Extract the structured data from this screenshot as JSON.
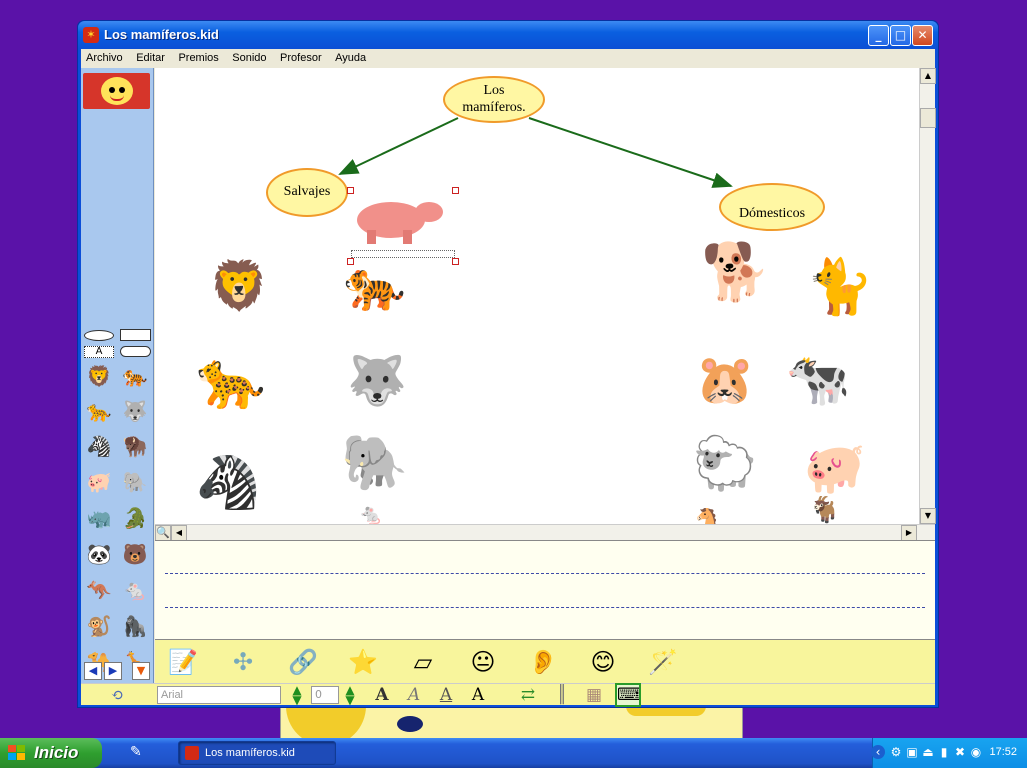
{
  "window": {
    "title": "Los mamíferos.kid",
    "menu": [
      "Archivo",
      "Editar",
      "Premios",
      "Sonido",
      "Profesor",
      "Ayuda"
    ]
  },
  "concept_map": {
    "root": "Los mamíferos.",
    "left_branch": "Salvajes",
    "right_branch": "Dómesticos"
  },
  "wild_animals": [
    "lion",
    "tiger",
    "puma",
    "wolf",
    "zebra",
    "elephant",
    "hippo"
  ],
  "domestic_animals": [
    "dog",
    "cat",
    "hamster",
    "cow",
    "sheep",
    "pig"
  ],
  "palette": {
    "text_tool_label": "A",
    "animals": [
      "lion",
      "tiger",
      "puma",
      "wolf",
      "zebra",
      "bison",
      "pig",
      "elephant",
      "rhino",
      "crocodile",
      "panda",
      "bear",
      "kangaroo",
      "mouse",
      "monkey",
      "gorilla",
      "camel",
      "giraffe"
    ]
  },
  "toolbar": {
    "tools": [
      "pencil-paper",
      "concept-map",
      "link-bubbles",
      "stars-box",
      "eraser",
      "speaker-face",
      "ear",
      "faces",
      "magic-wand"
    ]
  },
  "format": {
    "font": "Arial",
    "size": "0"
  },
  "taskbar": {
    "start_label": "Inicio",
    "task_title": "Los mamíferos.kid",
    "clock": "17:52"
  },
  "colors": {
    "desktop": "#5a12a8",
    "bubble_fill": "#fff7a3",
    "bubble_border": "#f09a2a",
    "arrow": "#1a6b1a"
  }
}
